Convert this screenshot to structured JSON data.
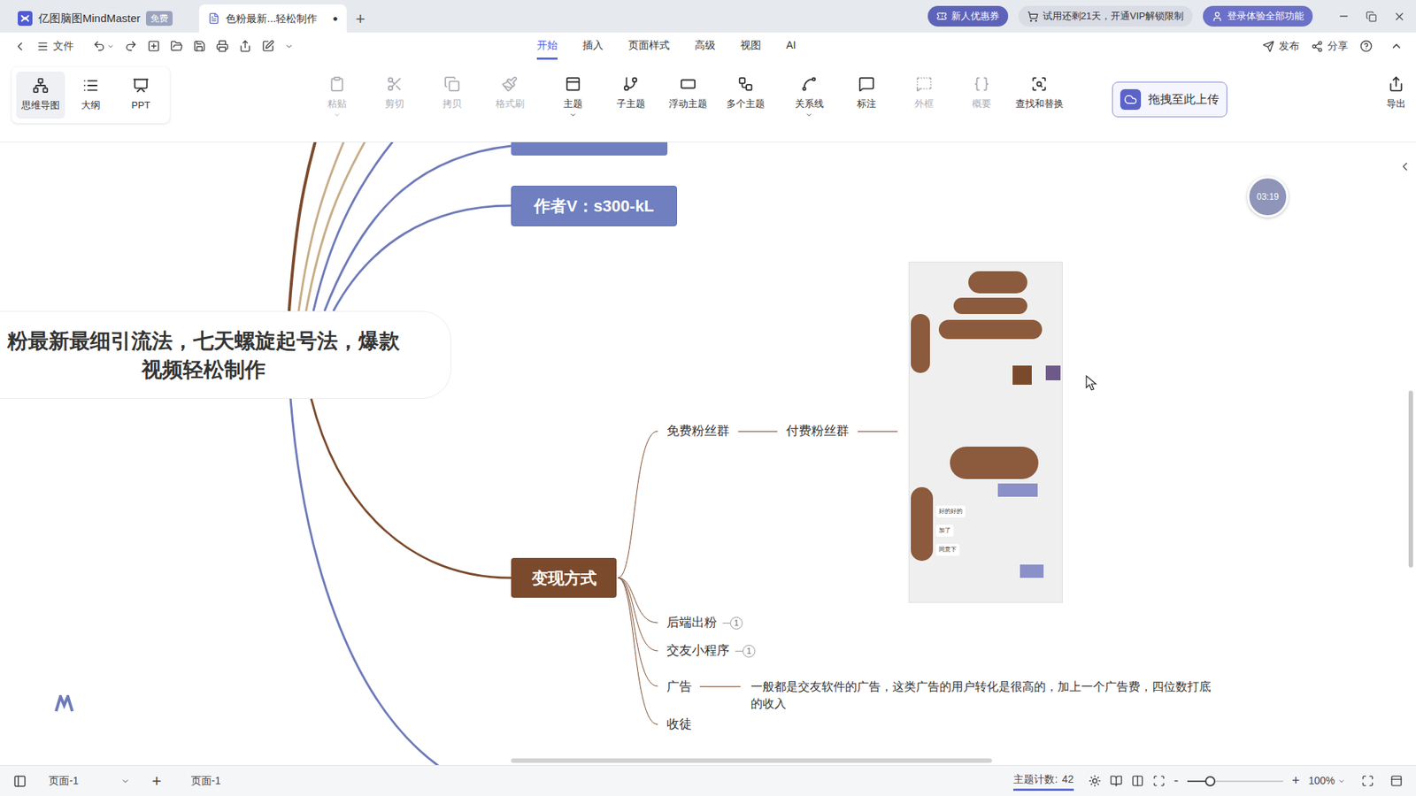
{
  "app_tab": {
    "title": "亿图脑图MindMaster",
    "badge": "免费",
    "selected": false
  },
  "doc_tab": {
    "title": "色粉最新...轻松制作",
    "unsaved_mark": "●",
    "selected": true
  },
  "new_tab": "+",
  "promos": {
    "coupon": "新人优惠券",
    "trial": "试用还剩21天，开通VIP解锁限制",
    "login": "登录体验全部功能"
  },
  "menu": {
    "file": "文件",
    "tabs": [
      {
        "label": "开始",
        "selected": true
      },
      {
        "label": "插入",
        "selected": false
      },
      {
        "label": "页面样式",
        "selected": false
      },
      {
        "label": "高级",
        "selected": false
      },
      {
        "label": "视图",
        "selected": false
      },
      {
        "label": "AI",
        "selected": false
      }
    ],
    "publish": "发布",
    "share": "分享"
  },
  "toolbar": {
    "views": [
      {
        "label": "思维导图",
        "selected": true
      },
      {
        "label": "大纲",
        "selected": false
      },
      {
        "label": "PPT",
        "selected": false
      }
    ],
    "groups": [
      [
        {
          "label": "粘贴",
          "disabled": true,
          "dropdown": true
        },
        {
          "label": "剪切",
          "disabled": true,
          "dropdown": false
        },
        {
          "label": "拷贝",
          "disabled": true,
          "dropdown": false
        },
        {
          "label": "格式刷",
          "disabled": true,
          "dropdown": false
        }
      ],
      [
        {
          "label": "主题",
          "disabled": false,
          "dropdown": true
        },
        {
          "label": "子主题",
          "disabled": false,
          "dropdown": false
        },
        {
          "label": "浮动主题",
          "disabled": false,
          "dropdown": false
        },
        {
          "label": "多个主题",
          "disabled": false,
          "dropdown": false
        }
      ],
      [
        {
          "label": "关系线",
          "disabled": false,
          "dropdown": true
        },
        {
          "label": "标注",
          "disabled": false,
          "dropdown": false
        },
        {
          "label": "外框",
          "disabled": true,
          "dropdown": false
        },
        {
          "label": "概要",
          "disabled": true,
          "dropdown": false
        },
        {
          "label": "查找和替换",
          "disabled": false,
          "dropdown": false
        }
      ]
    ],
    "upload": "拖拽至此上传",
    "export": "导出"
  },
  "mindmap": {
    "central": [
      "粉最新最细引流法，七天螺旋起号法，爆款",
      "视频轻松制作"
    ],
    "author_node": "作者V：s300-kL",
    "monetize": {
      "label": "变现方式",
      "children": [
        {
          "label": "免费粉丝群",
          "next": "付费粉丝群"
        },
        {
          "label": "后端出粉",
          "note": "1"
        },
        {
          "label": "交友小程序",
          "note": "1"
        },
        {
          "label": "广告",
          "detail": "一般都是交友软件的广告，这类广告的用户转化是很高的，加上一个广告费，四位数打底的收入"
        },
        {
          "label": "收徒"
        }
      ]
    },
    "image": {
      "bubbles": [
        "好的好的",
        "加了",
        "同意下"
      ]
    }
  },
  "timer": "03:19",
  "status_bar": {
    "page_select": "页面-1",
    "add": "+",
    "page_tab": "页面-1",
    "count_label": "主题计数:",
    "count": "42",
    "zoom_minus": "-",
    "zoom_plus": "+",
    "zoom_level": 0.24,
    "zoom": "100%"
  }
}
